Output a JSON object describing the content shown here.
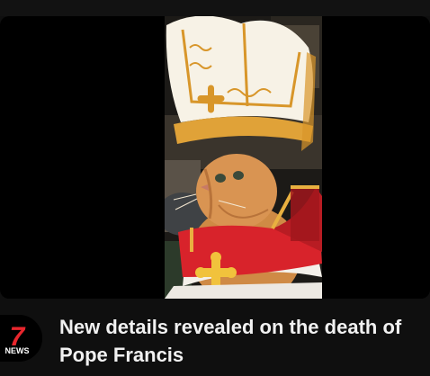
{
  "video": {
    "title": "New details revealed on the death of Pope Francis",
    "thumbnail_icon": "cat-in-pope-costume-image"
  },
  "channel": {
    "logo_number": "7",
    "logo_text": "NEWS",
    "logo_accent": "#e8262d"
  },
  "colors": {
    "background": "#0f0f0f",
    "title_text": "#f1f1f1",
    "mitre_gold": "#d8962a",
    "cape_red": "#d8232b"
  }
}
